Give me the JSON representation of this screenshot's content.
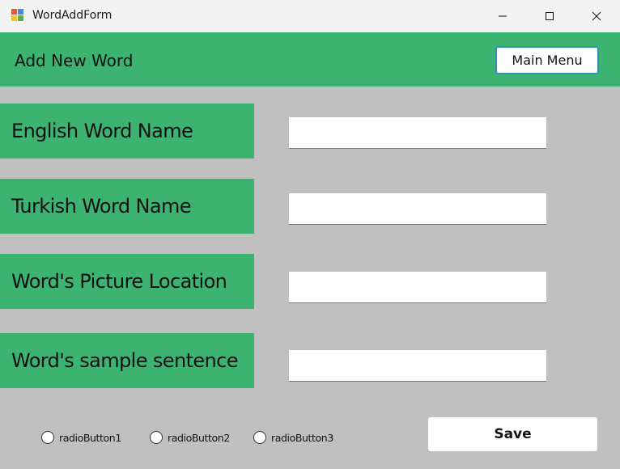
{
  "window": {
    "title": "WordAddForm",
    "icon": "winforms-app-icon",
    "controls": [
      "minimize-icon",
      "maximize-icon",
      "close-icon"
    ]
  },
  "header": {
    "title": "Add New Word",
    "main_menu_label": "Main Menu"
  },
  "fields": [
    {
      "label": "English Word Name",
      "value": ""
    },
    {
      "label": "Turkish Word Name",
      "value": ""
    },
    {
      "label": "Word's Picture Location",
      "value": ""
    },
    {
      "label": "Word's sample sentence",
      "value": ""
    }
  ],
  "radios": [
    {
      "label": "radioButton1",
      "checked": false
    },
    {
      "label": "radioButton2",
      "checked": false
    },
    {
      "label": "radioButton3",
      "checked": false
    }
  ],
  "save_label": "Save",
  "colors": {
    "accent_green": "#3cb371",
    "form_background": "#c0c0c0",
    "titlebar": "#f3f3f3",
    "button_border": "#2f8fb8"
  }
}
